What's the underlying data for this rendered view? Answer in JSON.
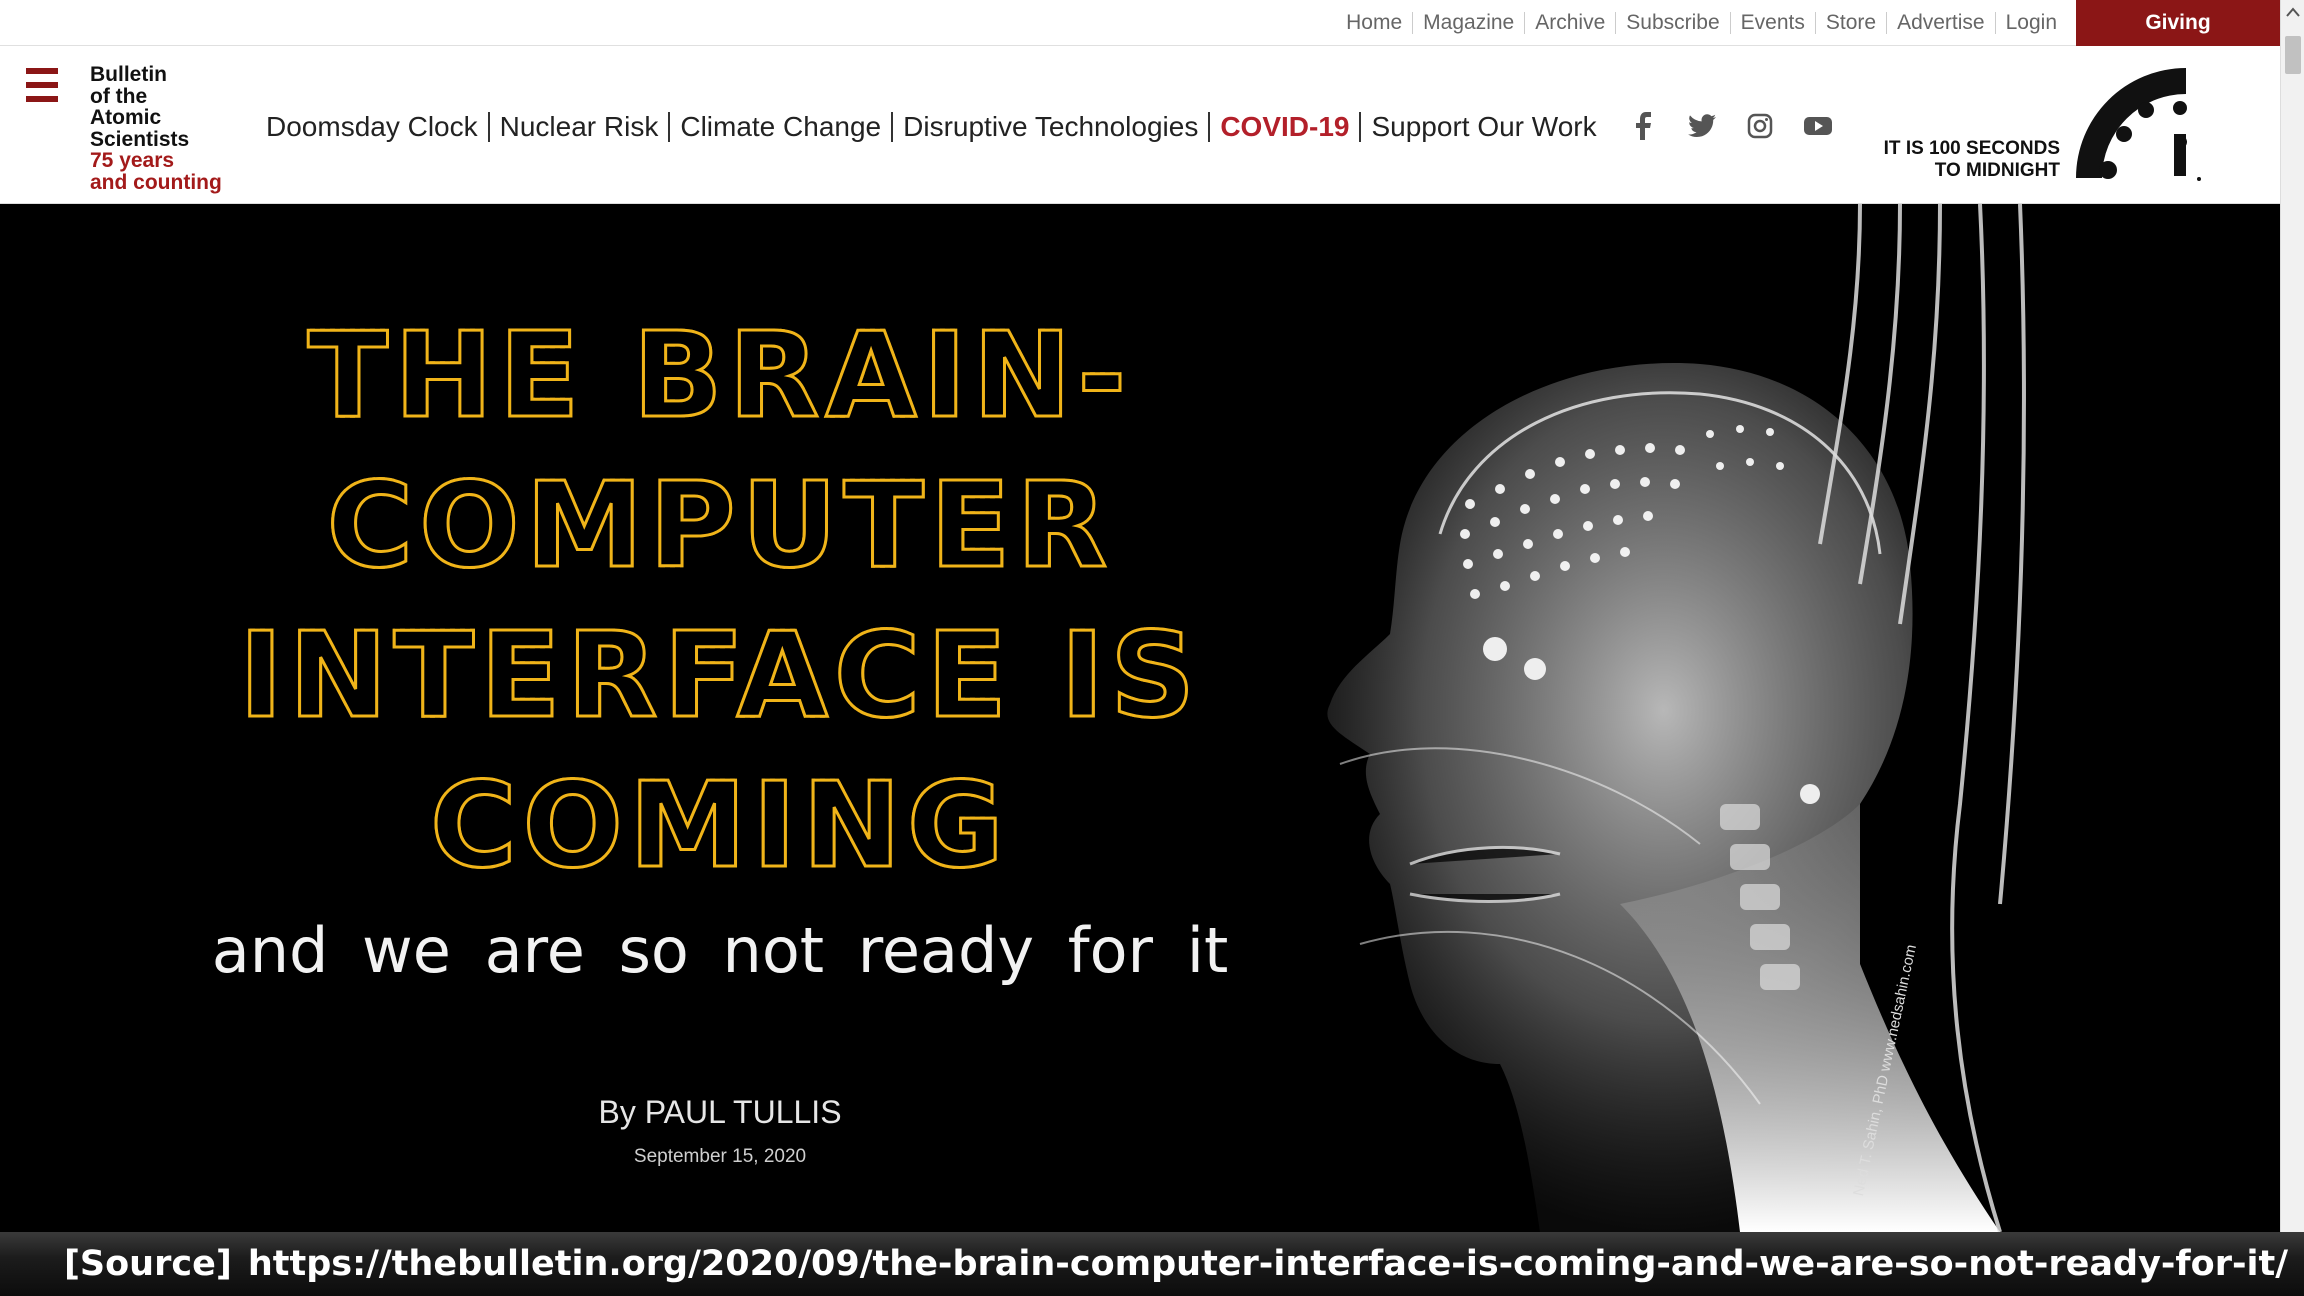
{
  "utility_nav": {
    "links": [
      "Home",
      "Magazine",
      "Archive",
      "Subscribe",
      "Events",
      "Store",
      "Advertise",
      "Login"
    ],
    "giving_label": "Giving"
  },
  "logo": {
    "name_lines": [
      "Bulletin",
      "of the",
      "Atomic",
      "Scientists"
    ],
    "tagline_lines": [
      "75 years",
      "and counting"
    ]
  },
  "main_nav": {
    "links": [
      "Doomsday Clock",
      "Nuclear Risk",
      "Climate Change",
      "Disruptive Technologies",
      "COVID-19",
      "Support Our Work"
    ]
  },
  "social": [
    "facebook-icon",
    "twitter-icon",
    "instagram-icon",
    "youtube-icon"
  ],
  "clock": {
    "line1": "IT IS 100 SECONDS",
    "line2": "TO MIDNIGHT"
  },
  "article": {
    "headline_lines": [
      "THE BRAIN-",
      "COMPUTER",
      "INTERFACE IS",
      "COMING"
    ],
    "subheadline": "and we are so not ready for it",
    "byline": "By PAUL TULLIS",
    "date": "September 15, 2020",
    "image_credit": "Ned T. Sahin, PhD   www.nedsahin.com"
  },
  "source": {
    "label": "[Source]",
    "url": "https://thebulletin.org/2020/09/the-brain-computer-interface-is-coming-and-we-are-so-not-ready-for-it/"
  },
  "colors": {
    "brand_red": "#8b1616",
    "covid_red": "#b3202a",
    "headline_yellow": "#f0b419"
  }
}
